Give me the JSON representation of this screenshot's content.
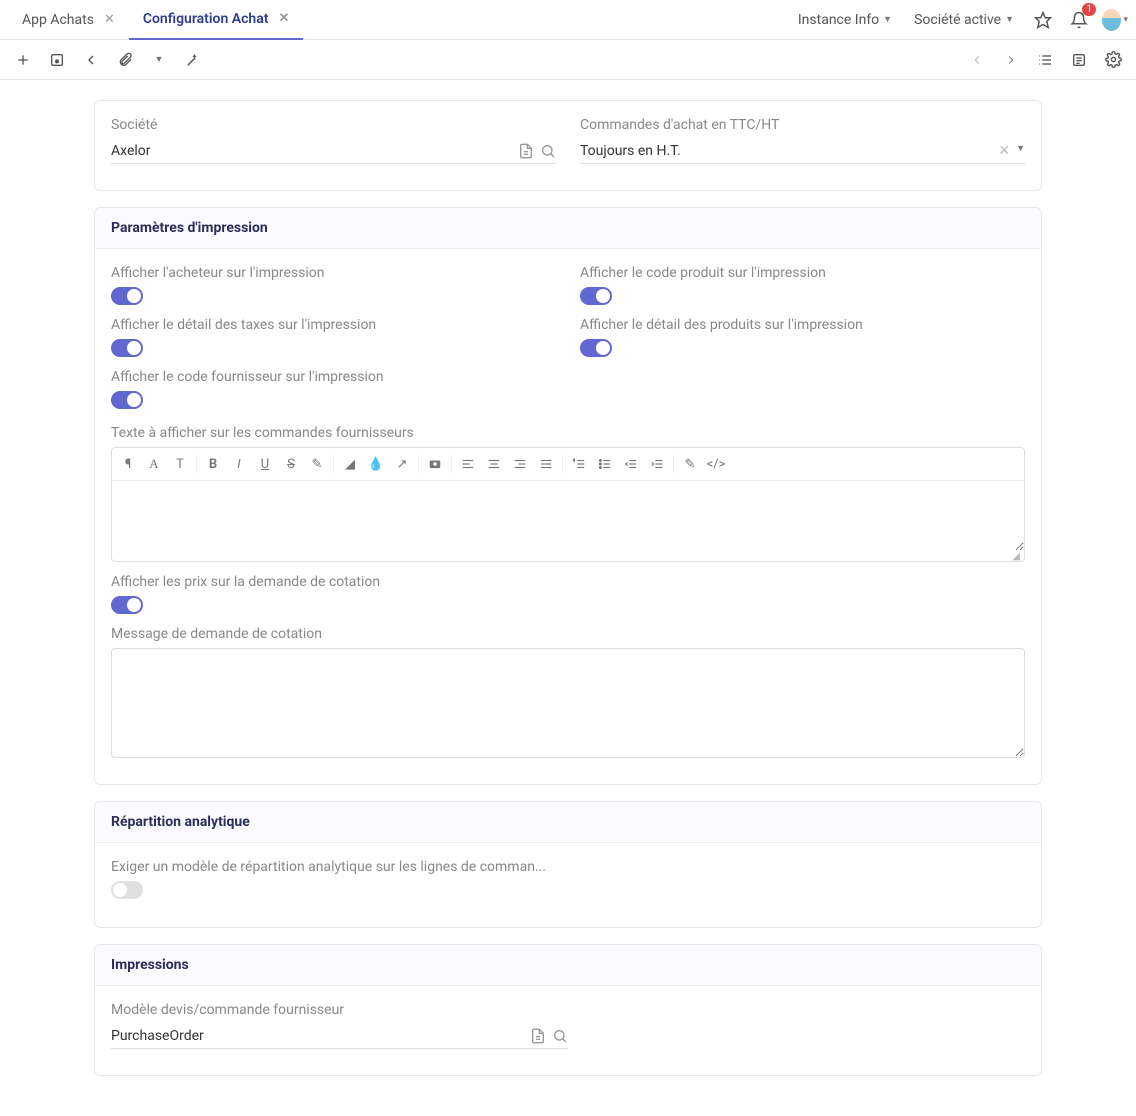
{
  "tabs": [
    {
      "label": "App Achats",
      "active": false
    },
    {
      "label": "Configuration Achat",
      "active": true
    }
  ],
  "header": {
    "instance_info": "Instance Info",
    "active_company": "Société active",
    "notification_count": "1"
  },
  "form_top": {
    "company_label": "Société",
    "company_value": "Axelor",
    "orders_mode_label": "Commandes d'achat en TTC/HT",
    "orders_mode_value": "Toujours en H.T."
  },
  "print_params": {
    "title": "Paramètres d'impression",
    "show_buyer": "Afficher l'acheteur sur l'impression",
    "show_product_code": "Afficher le code produit sur l'impression",
    "show_tax_detail": "Afficher le détail des taxes sur l'impression",
    "show_product_detail": "Afficher le détail des produits sur l'impression",
    "show_supplier_code": "Afficher le code fournisseur sur l'impression",
    "supplier_text_label": "Texte à afficher sur les commandes fournisseurs",
    "show_prices_rfq": "Afficher les prix sur la demande de cotation",
    "rfq_message_label": "Message de demande de cotation"
  },
  "analytic": {
    "title": "Répartition analytique",
    "require_template": "Exiger un modèle de répartition analytique sur les lignes de comman..."
  },
  "impressions": {
    "title": "Impressions",
    "template_label": "Modèle devis/commande fournisseur",
    "template_value": "PurchaseOrder"
  }
}
